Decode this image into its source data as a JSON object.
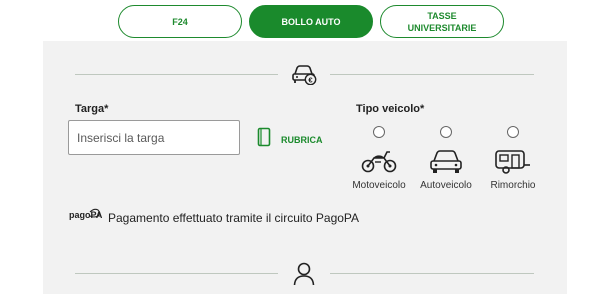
{
  "tabs": [
    {
      "label": "F24"
    },
    {
      "label": "BOLLO AUTO"
    },
    {
      "label_line1": "TASSE",
      "label_line2": "UNIVERSITARIE"
    }
  ],
  "form": {
    "targa_label": "Targa*",
    "targa_placeholder": "Inserisci la targa",
    "rubrica_label": "RUBRICA",
    "tipo_veicolo_label": "Tipo veicolo*",
    "vehicles": [
      {
        "label": "Motoveicolo",
        "icon": "motorcycle-icon"
      },
      {
        "label": "Autoveicolo",
        "icon": "car-icon"
      },
      {
        "label": "Rimorchio",
        "icon": "trailer-icon"
      }
    ]
  },
  "pagopa": {
    "logo_text": "pagoPA",
    "message": "Pagamento effettuato tramite il circuito PagoPA"
  },
  "colors": {
    "accent": "#1a8a2c",
    "panel_bg": "#f2f2f2"
  }
}
